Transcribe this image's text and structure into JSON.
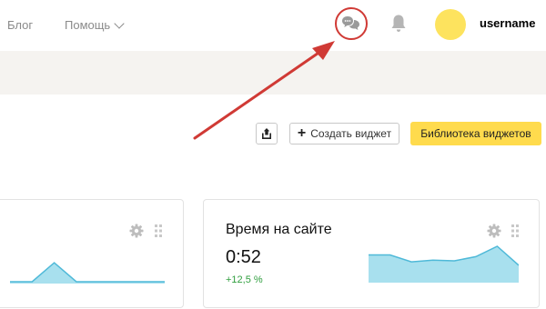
{
  "nav": {
    "blog": "Блог",
    "help": "Помощь",
    "username": "username"
  },
  "toolbar": {
    "create_widget": "Создать виджет",
    "widget_library": "Библиотека виджетов"
  },
  "widgets": [
    {
      "sparkline": [
        0,
        0,
        0.95,
        0,
        0,
        0,
        0,
        0
      ]
    },
    {
      "title": "Время на сайте",
      "value": "0:52",
      "delta": "+12,5 %",
      "sparkline": [
        0.75,
        0.75,
        0.55,
        0.6,
        0.58,
        0.7,
        1.0,
        0.45
      ]
    }
  ],
  "colors": {
    "accent_yellow": "#ffdb4d",
    "highlight_circle": "#d03a35",
    "arrow": "#d03a35",
    "sparkline_fill": "#a8e0ee",
    "sparkline_stroke": "#4fb9d8",
    "positive": "#2f9e3e",
    "band": "#f5f3f0"
  }
}
